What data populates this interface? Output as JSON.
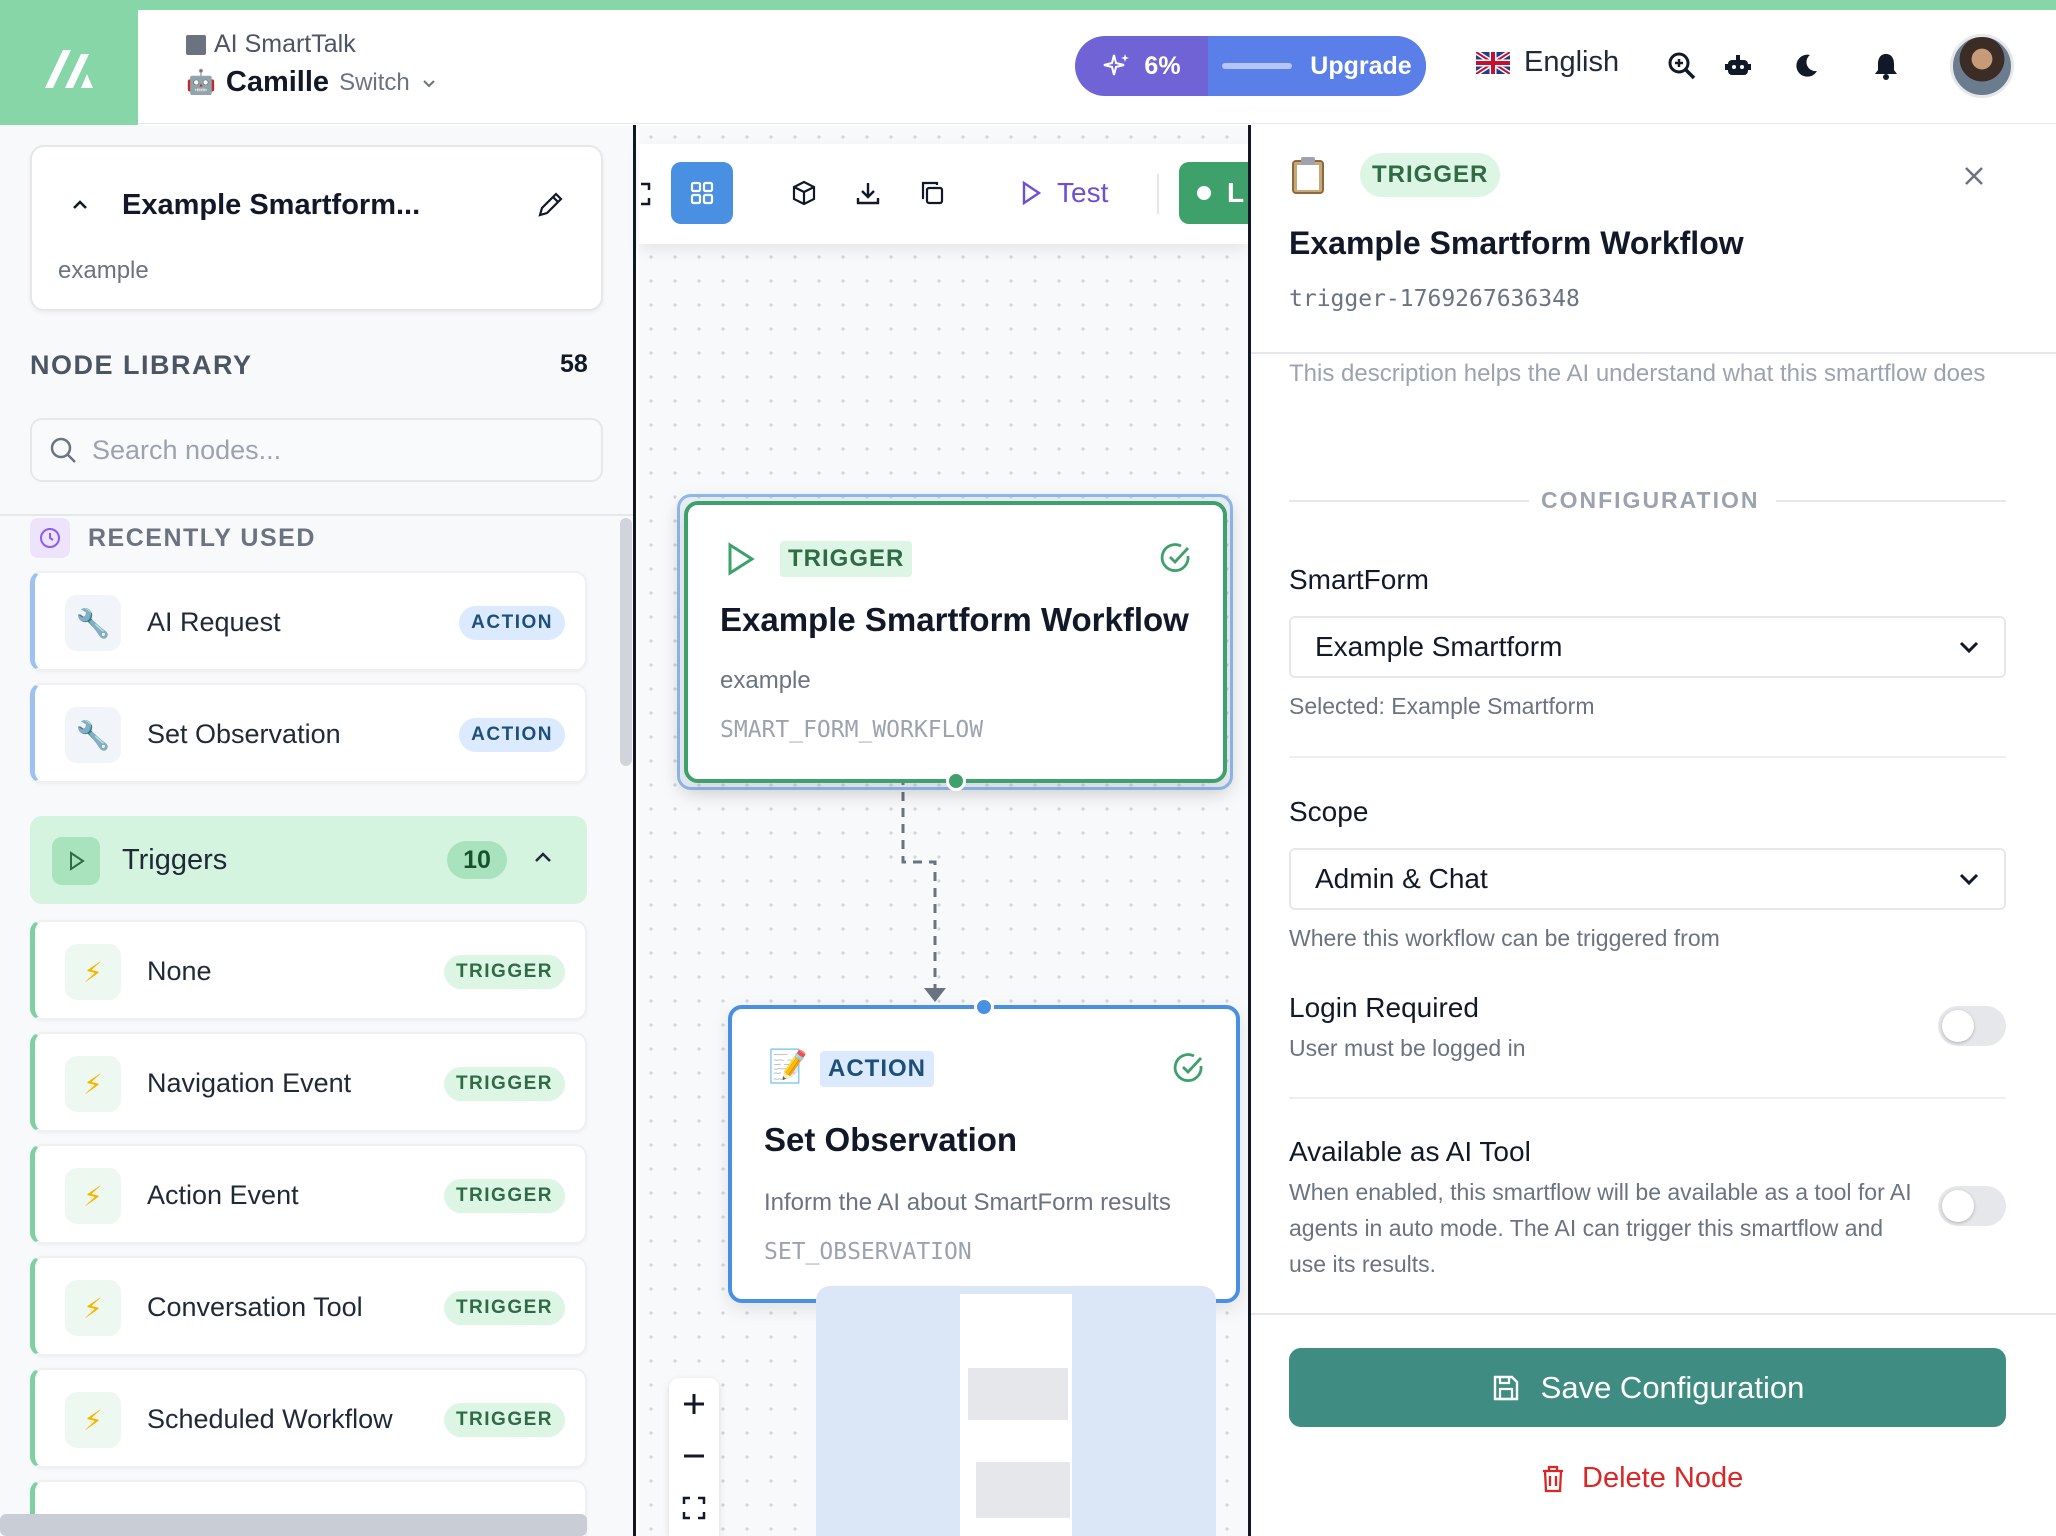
{
  "header": {
    "org_name": "AI SmartTalk",
    "user_name": "Camille",
    "switch_label": "Switch",
    "usage_percent": "6%",
    "upgrade_label": "Upgrade",
    "language": "English",
    "icons": [
      "sparkles-icon",
      "uk-flag-icon",
      "zoom-in-icon",
      "robot-icon",
      "moon-icon",
      "bell-icon",
      "avatar"
    ]
  },
  "sidebar": {
    "workflow_title": "Example Smartform...",
    "workflow_description": "example",
    "node_library_title": "NODE LIBRARY",
    "node_count": "58",
    "search_placeholder": "Search nodes...",
    "recently_used_label": "RECENTLY USED",
    "recent_items": [
      {
        "label": "AI Request",
        "badge": "ACTION"
      },
      {
        "label": "Set Observation",
        "badge": "ACTION"
      }
    ],
    "triggers_category": {
      "label": "Triggers",
      "count": "10"
    },
    "trigger_items": [
      {
        "label": "None",
        "badge": "TRIGGER"
      },
      {
        "label": "Navigation Event",
        "badge": "TRIGGER"
      },
      {
        "label": "Action Event",
        "badge": "TRIGGER"
      },
      {
        "label": "Conversation Tool",
        "badge": "TRIGGER"
      },
      {
        "label": "Scheduled Workflow",
        "badge": "TRIGGER"
      }
    ]
  },
  "canvas": {
    "toolbar": {
      "test_label": "Test",
      "launch_label": "L"
    },
    "trigger_node": {
      "badge": "TRIGGER",
      "title": "Example Smartform Workflow",
      "description": "example",
      "code": "SMART_FORM_WORKFLOW"
    },
    "action_node": {
      "badge": "ACTION",
      "title": "Set Observation",
      "description": "Inform the AI about SmartForm results",
      "code": "SET_OBSERVATION"
    }
  },
  "panel": {
    "kind_badge": "TRIGGER",
    "title": "Example Smartform Workflow",
    "node_id": "trigger-1769267636348",
    "description_hint": "This description helps the AI understand what this smartflow does",
    "config_heading": "CONFIGURATION",
    "smartform_label": "SmartForm",
    "smartform_value": "Example Smartform",
    "smartform_selected": "Selected: Example Smartform",
    "scope_label": "Scope",
    "scope_value": "Admin & Chat",
    "scope_help": "Where this workflow can be triggered from",
    "login_label": "Login Required",
    "login_help": "User must be logged in",
    "login_enabled": false,
    "ai_tool_label": "Available as AI Tool",
    "ai_tool_help": "When enabled, this smartflow will be available as a tool for AI agents in auto mode. The AI can trigger this smartflow and use its results.",
    "ai_tool_enabled": false,
    "save_label": "Save Configuration",
    "delete_label": "Delete Node"
  },
  "colors": {
    "brand_green": "#86d6a7",
    "trigger_green": "#3ea06a",
    "action_blue": "#4a90e2",
    "save_teal": "#3f8c82",
    "delete_red": "#dc2626",
    "upgrade_purple": "#6f63d6"
  }
}
